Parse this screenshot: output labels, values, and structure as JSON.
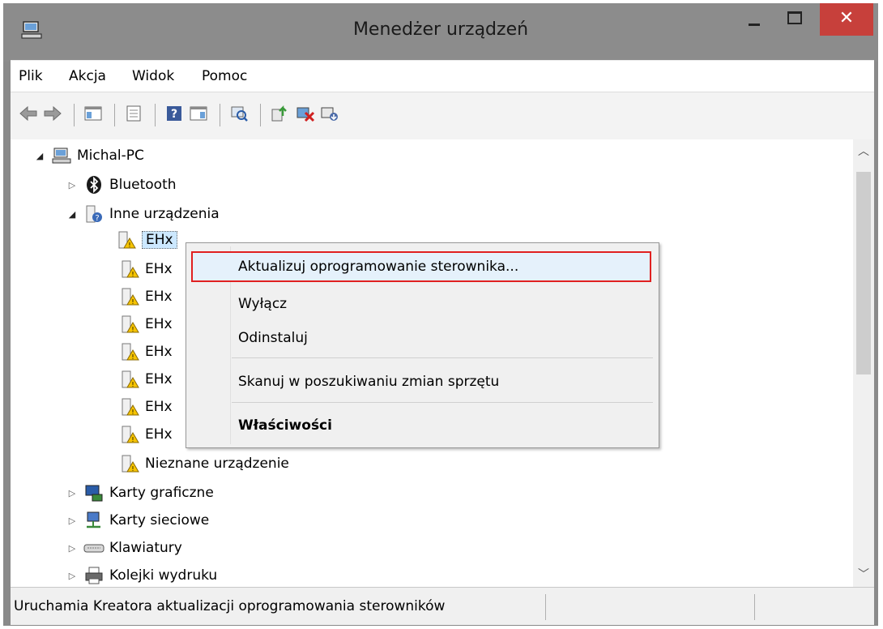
{
  "window": {
    "title": "Menedżer urządzeń",
    "close_glyph": "✕"
  },
  "menu": [
    "Plik",
    "Akcja",
    "Widok",
    "Pomoc"
  ],
  "toolbar_icons": [
    "back-arrow-icon",
    "forward-arrow-icon",
    "show-hide-console-tree-icon",
    "properties-icon",
    "help-icon",
    "show-action-pane-icon",
    "scan-hardware-icon",
    "update-driver-icon",
    "disable-device-icon",
    "uninstall-device-icon"
  ],
  "tree": {
    "root": "Michal-PC",
    "bluetooth": "Bluetooth",
    "other_devices": "Inne urządzenia",
    "ehx": "EHx",
    "unknown_device": "Nieznane urządzenie",
    "graphics": "Karty graficzne",
    "network": "Karty sieciowe",
    "keyboards": "Klawiatury",
    "print_queues": "Kolejki wydruku"
  },
  "context_menu": {
    "update_driver": "Aktualizuj oprogramowanie sterownika...",
    "disable": "Wyłącz",
    "uninstall": "Odinstaluj",
    "scan": "Skanuj w poszukiwaniu zmian sprzętu",
    "properties": "Właściwości"
  },
  "status": {
    "text": "Uruchamia Kreatora aktualizacji oprogramowania sterowników"
  },
  "colors": {
    "close_button": "#c7403b",
    "highlight_border": "#e02020",
    "titlebar": "#8c8c8c"
  }
}
